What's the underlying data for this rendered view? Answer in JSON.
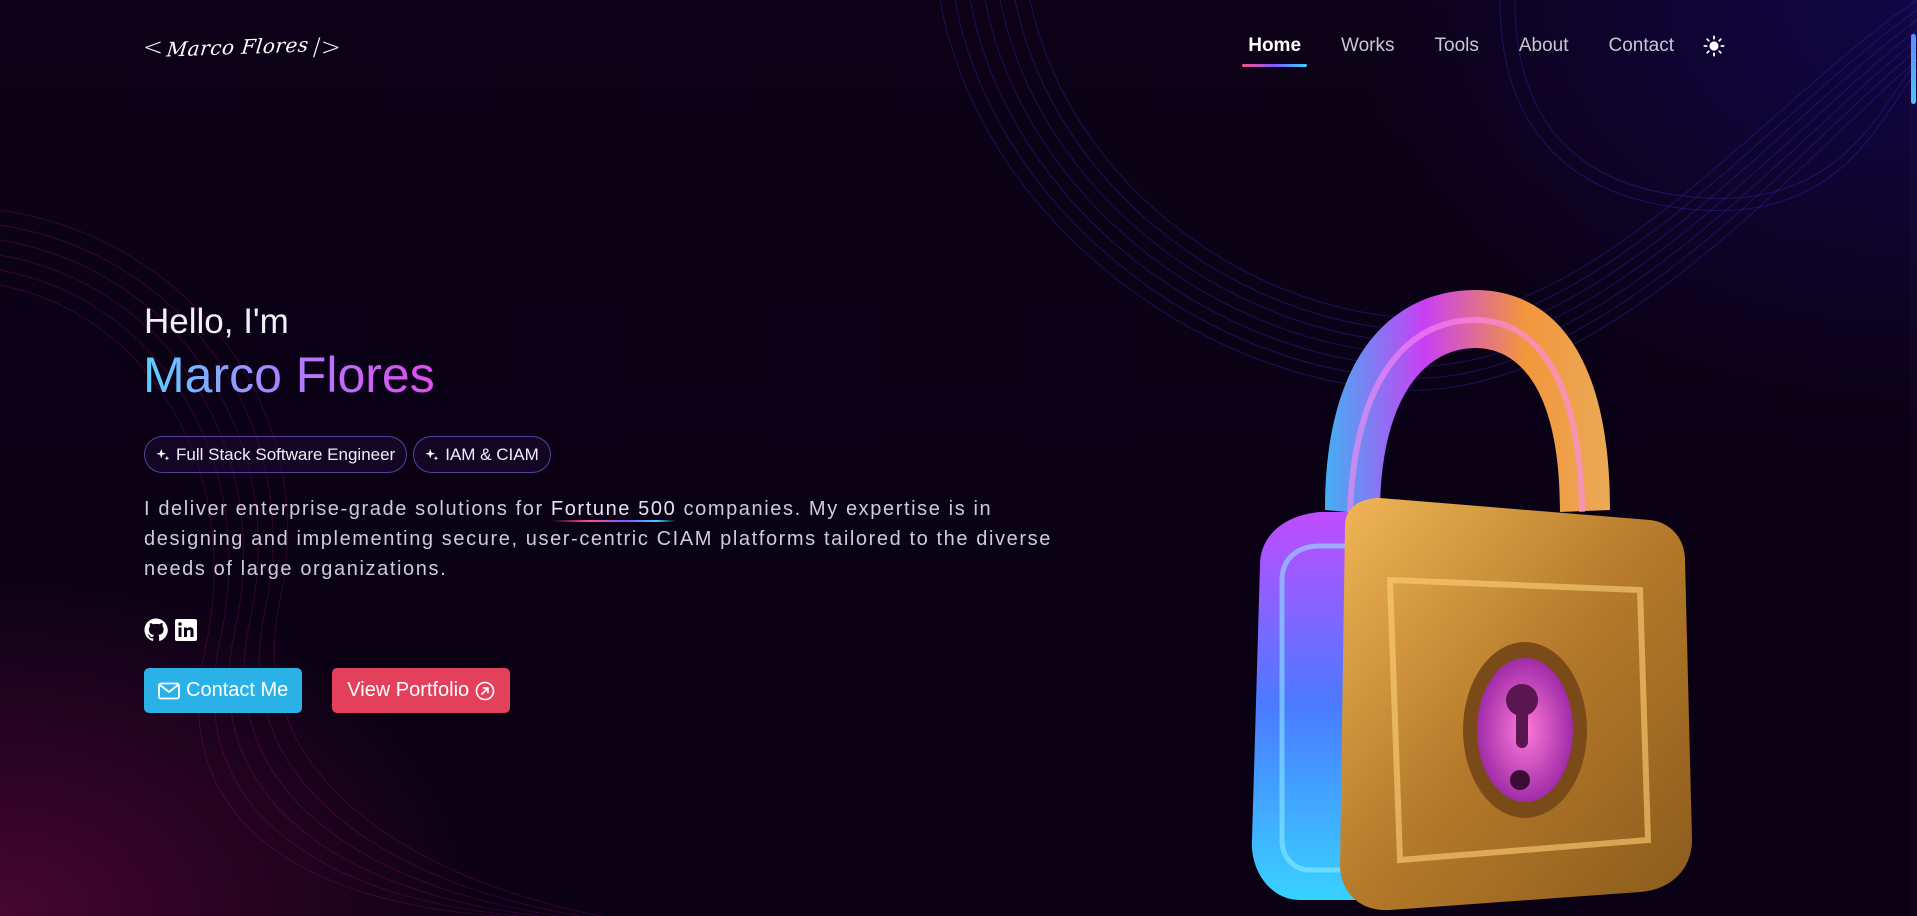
{
  "header": {
    "logo_open": "<",
    "logo_name": "Marco Flores",
    "logo_close": "/>",
    "nav": [
      {
        "label": "Home",
        "active": true
      },
      {
        "label": "Works",
        "active": false
      },
      {
        "label": "Tools",
        "active": false
      },
      {
        "label": "About",
        "active": false
      },
      {
        "label": "Contact",
        "active": false
      }
    ],
    "theme_icon": "sun-icon"
  },
  "hero": {
    "greeting": "Hello, I'm",
    "name": "Marco Flores",
    "badges": [
      "Full Stack Software Engineer",
      "IAM & CIAM"
    ],
    "intro_before": "I deliver enterprise-grade solutions for ",
    "intro_highlight": "Fortune 500",
    "intro_after": " companies. My expertise is in designing and implementing secure, user-centric CIAM platforms tailored to the diverse needs of large organizations.",
    "socials": [
      "github-icon",
      "linkedin-icon"
    ],
    "contact_button": "Contact Me",
    "portfolio_button": "View Portfolio"
  },
  "colors": {
    "background": "#0b0114",
    "contact_button": "#2ab1e8",
    "portfolio_button": "#e3405c",
    "name_gradient_start": "#5ad0ff",
    "name_gradient_end": "#e14bf0"
  }
}
